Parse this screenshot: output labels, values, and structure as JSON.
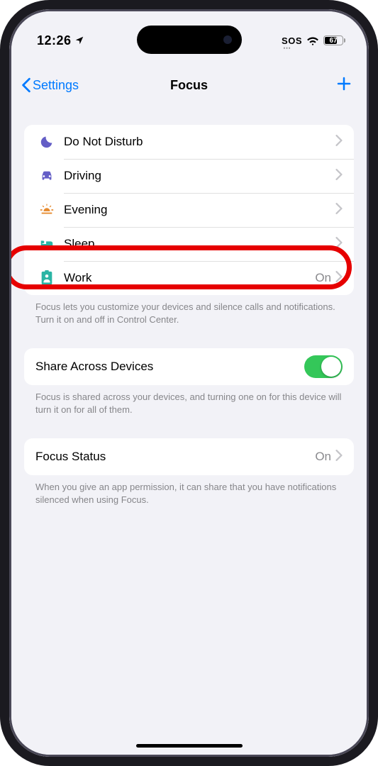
{
  "statusbar": {
    "time": "12:26",
    "sos": "SOS",
    "battery_pct": "67"
  },
  "nav": {
    "back_label": "Settings",
    "title": "Focus"
  },
  "focus_modes": [
    {
      "label": "Do Not Disturb",
      "icon": "moon",
      "color": "#645ec6",
      "status": ""
    },
    {
      "label": "Driving",
      "icon": "car",
      "color": "#645ec6",
      "status": ""
    },
    {
      "label": "Evening",
      "icon": "sunset",
      "color": "#e68a2e",
      "status": ""
    },
    {
      "label": "Sleep",
      "icon": "bed",
      "color": "#2ab5a5",
      "status": ""
    },
    {
      "label": "Work",
      "icon": "badge",
      "color": "#2ab5a5",
      "status": "On"
    }
  ],
  "focus_footer": "Focus lets you customize your devices and silence calls and notifications. Turn it on and off in Control Center.",
  "share": {
    "label": "Share Across Devices",
    "footer": "Focus is shared across your devices, and turning one on for this device will turn it on for all of them."
  },
  "status": {
    "label": "Focus Status",
    "value": "On",
    "footer": "When you give an app permission, it can share that you have notifications silenced when using Focus."
  }
}
